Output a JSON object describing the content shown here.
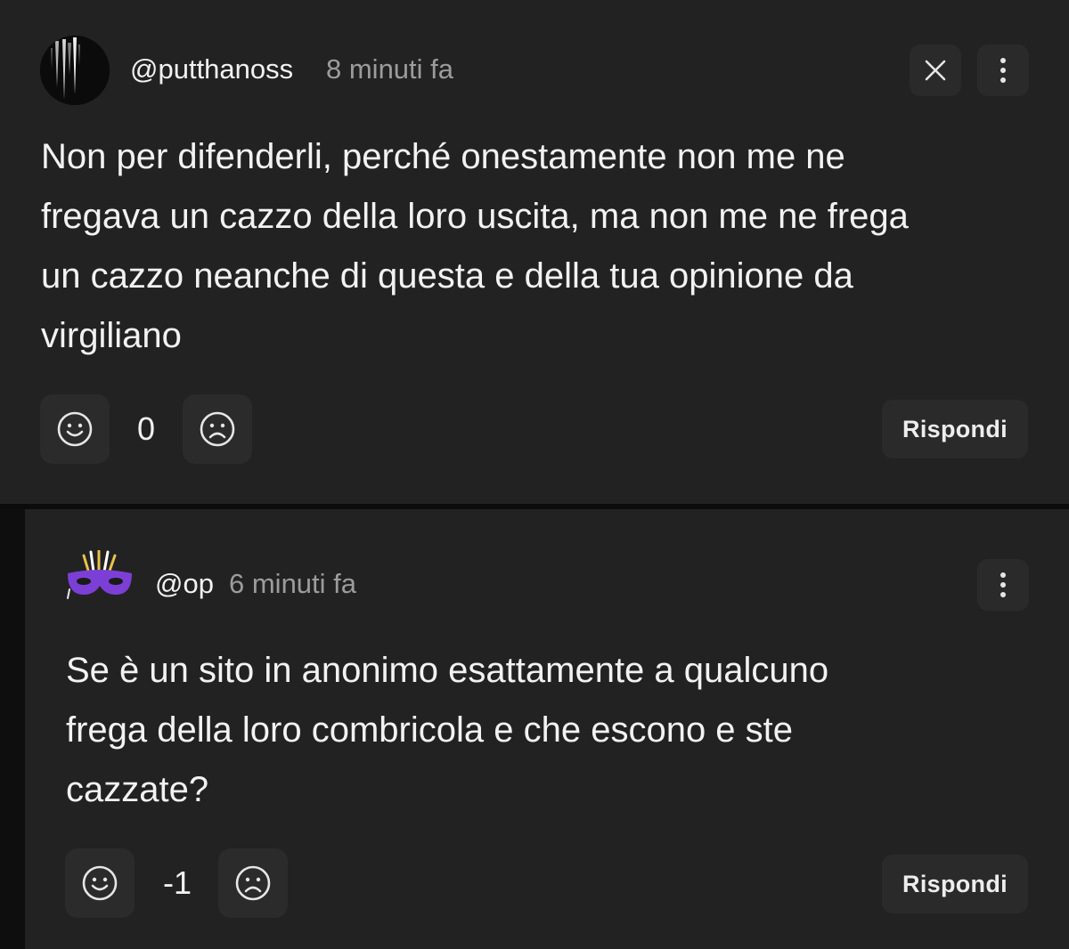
{
  "comments": [
    {
      "username": "@putthanoss",
      "time": "8 minuti fa",
      "avatar": "dark-streaks-avatar",
      "lines": [
        "Non per difenderli, perché onestamente non me ne",
        "fregava un cazzo della loro uscita, ma non me ne frega",
        "un cazzo neanche di questa e della tua opinione da",
        "virgiliano"
      ],
      "score": "0",
      "reply_label": "Rispondi"
    },
    {
      "username": "@op",
      "time": "6 minuti fa",
      "avatar": "purple-mask-avatar",
      "lines": [
        "Se è un sito in anonimo esattamente a qualcuno",
        "frega della loro combricola e che escono e ste",
        "cazzate?"
      ],
      "score": "-1",
      "reply_label": "Rispondi"
    }
  ],
  "colors": {
    "card_background": "#222222",
    "page_background": "#121212",
    "button_background": "#2a2a2a",
    "muted_text": "#9c9c9c",
    "mask_purple": "#7b3fd6"
  }
}
